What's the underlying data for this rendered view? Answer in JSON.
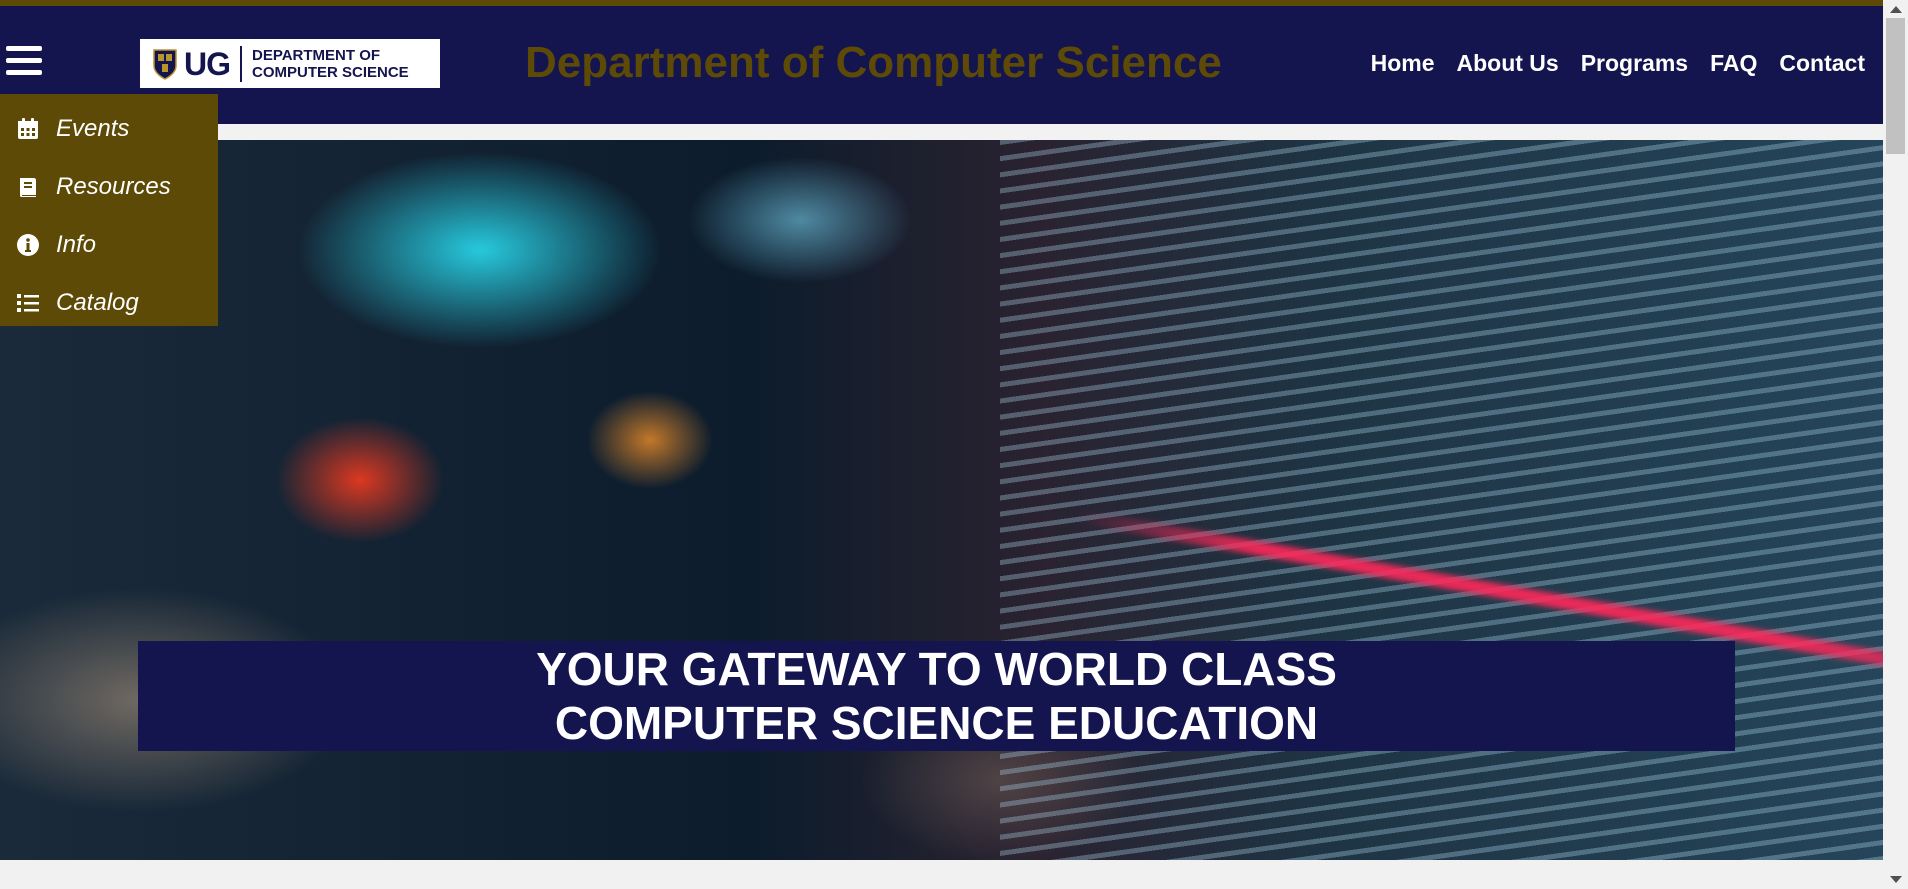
{
  "header": {
    "logo": {
      "short": "UG",
      "line1": "DEPARTMENT OF",
      "line2": "COMPUTER SCIENCE"
    },
    "title": "Department of Computer Science",
    "nav": [
      "Home",
      "About Us",
      "Programs",
      "FAQ",
      "Contact"
    ]
  },
  "sidebar": {
    "items": [
      {
        "label": "Events",
        "icon": "calendar-icon"
      },
      {
        "label": "Resources",
        "icon": "book-icon"
      },
      {
        "label": "Info",
        "icon": "info-circle-icon"
      },
      {
        "label": "Catalog",
        "icon": "list-icon"
      }
    ]
  },
  "hero": {
    "line1": "YOUR GATEWAY TO WORLD CLASS",
    "line2": "COMPUTER SCIENCE EDUCATION"
  },
  "colors": {
    "navy": "#14144f",
    "gold": "#5c4a06",
    "white": "#ffffff"
  }
}
